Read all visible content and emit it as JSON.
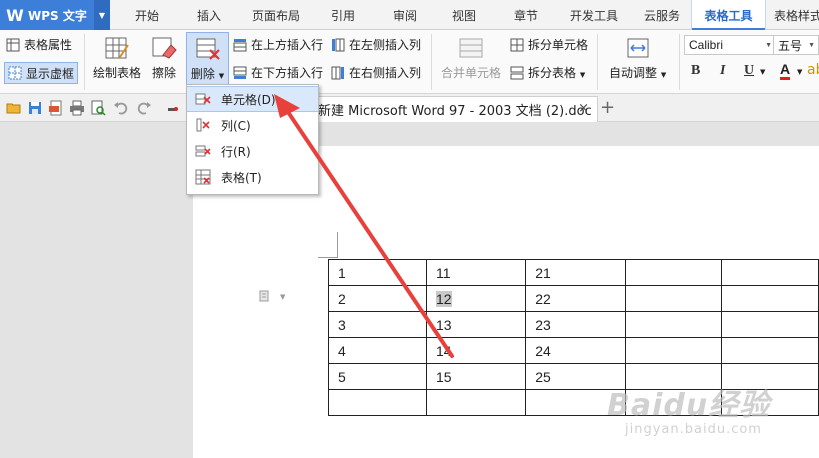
{
  "app": {
    "logo": "W",
    "name": "WPS 文字"
  },
  "tabs": [
    "开始",
    "插入",
    "页面布局",
    "引用",
    "审阅",
    "视图",
    "章节",
    "开发工具",
    "云服务",
    "表格工具",
    "表格样式"
  ],
  "active_tab": "表格工具",
  "ribbon": {
    "table_props": "表格属性",
    "show_grid": "显示虚框",
    "draw_table": "绘制表格",
    "erase": "擦除",
    "delete": "删除",
    "insert_above": "在上方插入行",
    "insert_below": "在下方插入行",
    "insert_left": "在左侧插入列",
    "insert_right": "在右侧插入列",
    "merge_cells": "合并单元格",
    "split_cells": "拆分单元格",
    "split_table": "拆分表格",
    "autofit": "自动调整",
    "font_name": "Calibri",
    "font_size": "五号",
    "bold": "B",
    "italic": "I",
    "underline": "U",
    "font_color": "A"
  },
  "doc_tab": {
    "title": "新建 Microsoft Word 97 - 2003 文档 (2).doc",
    "close": "×",
    "new": "+"
  },
  "delete_menu": {
    "items": [
      {
        "label": "单元格(D)...",
        "icon": "delete-cell-icon"
      },
      {
        "label": "列(C)",
        "icon": "delete-column-icon"
      },
      {
        "label": "行(R)",
        "icon": "delete-row-icon"
      },
      {
        "label": "表格(T)",
        "icon": "delete-table-icon"
      }
    ]
  },
  "table": {
    "rows": [
      [
        "1",
        "11",
        "21",
        "",
        ""
      ],
      [
        "2",
        "12",
        "22",
        "",
        ""
      ],
      [
        "3",
        "13",
        "23",
        "",
        ""
      ],
      [
        "4",
        "14",
        "24",
        "",
        ""
      ],
      [
        "5",
        "15",
        "25",
        "",
        ""
      ],
      [
        "",
        "",
        "",
        "",
        ""
      ]
    ]
  },
  "watermark": {
    "line1": "Baidu经验",
    "line2": "jingyan.baidu.com"
  },
  "colors": {
    "accent": "#3d7fd8",
    "arrow": "#e8413c",
    "menu_hover": "#d9e8fb"
  }
}
